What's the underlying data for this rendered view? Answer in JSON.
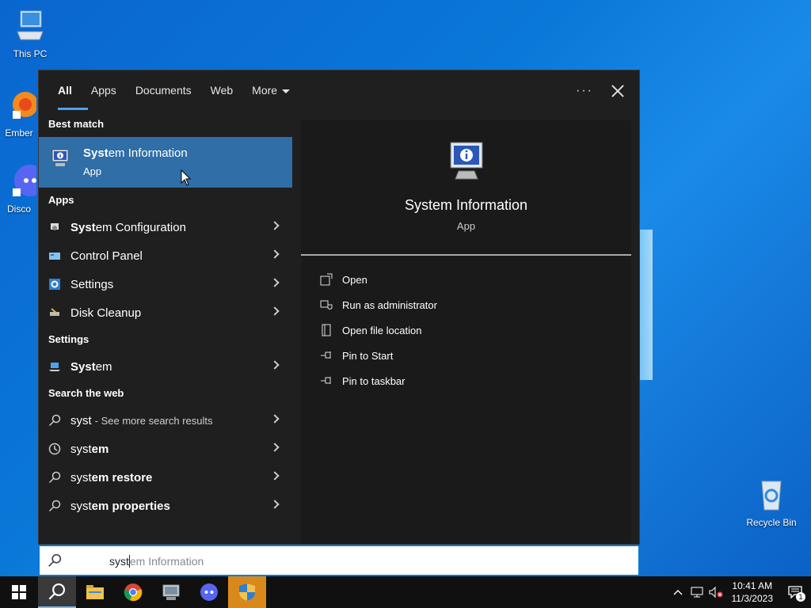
{
  "desktop": {
    "icons": [
      {
        "label": "This PC"
      },
      {
        "label": "Ember"
      },
      {
        "label": "Disco"
      },
      {
        "label": "Recycle Bin"
      }
    ]
  },
  "search_panel": {
    "tabs": [
      {
        "label": "All",
        "active": true
      },
      {
        "label": "Apps"
      },
      {
        "label": "Documents"
      },
      {
        "label": "Web"
      },
      {
        "label": "More"
      }
    ],
    "more_options_icon": "ellipsis-icon",
    "close_icon": "close-icon",
    "best_match_heading": "Best match",
    "best_match": {
      "name_bold": "Syst",
      "name_rest": "em Information",
      "type": "App"
    },
    "apps_heading": "Apps",
    "apps": [
      {
        "name_bold": "Syst",
        "name_rest": "em Configuration",
        "icon": "system-configuration-icon"
      },
      {
        "name_bold": "",
        "name_rest": "Control Panel",
        "icon": "control-panel-icon"
      },
      {
        "name_bold": "",
        "name_rest": "Settings",
        "icon": "settings-gear-icon"
      },
      {
        "name_bold": "",
        "name_rest": "Disk Cleanup",
        "icon": "disk-cleanup-icon"
      }
    ],
    "settings_heading": "Settings",
    "settings": [
      {
        "name_bold": "Syst",
        "name_rest": "em",
        "icon": "laptop-icon"
      }
    ],
    "web_heading": "Search the web",
    "web": [
      {
        "typed": "syst",
        "suffix": " - See more search results",
        "icon": "search-icon"
      },
      {
        "typed": "syst",
        "rest": "em",
        "icon": "history-icon"
      },
      {
        "typed": "syst",
        "rest": "em restore",
        "icon": "search-icon"
      },
      {
        "typed": "syst",
        "rest": "em properties",
        "icon": "search-icon"
      }
    ],
    "preview": {
      "title": "System Information",
      "type": "App",
      "actions": [
        {
          "label": "Open",
          "icon": "open-icon"
        },
        {
          "label": "Run as administrator",
          "icon": "shield-icon"
        },
        {
          "label": "Open file location",
          "icon": "file-location-icon"
        },
        {
          "label": "Pin to Start",
          "icon": "pin-icon"
        },
        {
          "label": "Pin to taskbar",
          "icon": "pin-icon"
        }
      ]
    }
  },
  "searchbox": {
    "typed": "syst",
    "suggestion": "em Information"
  },
  "taskbar": {
    "apps": [
      "windows-start-icon",
      "search-icon",
      "file-explorer-icon",
      "chrome-icon",
      "system-information-icon",
      "discord-icon",
      "user-account-control-icon"
    ],
    "time": "10:41 AM",
    "date": "11/3/2023",
    "notification_count": "1"
  }
}
